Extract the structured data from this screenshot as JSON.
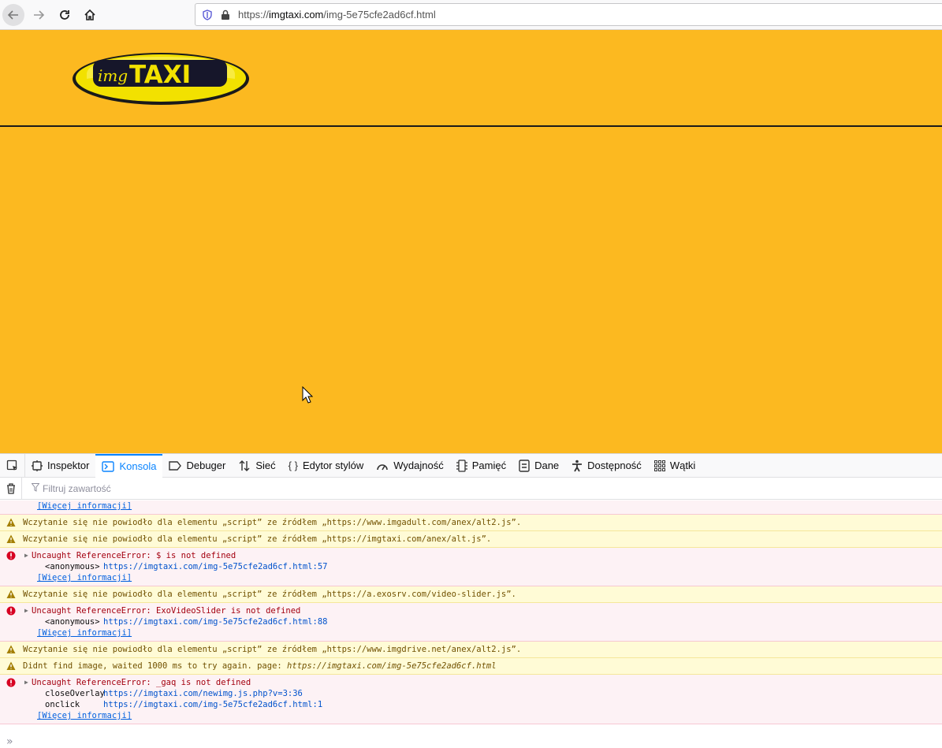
{
  "browser": {
    "url_scheme": "https://",
    "url_host": "imgtaxi.com",
    "url_path": "/img-5e75cfe2ad6cf.html"
  },
  "page": {
    "logo_prefix": "img",
    "logo_main": "TAXI",
    "background": "#fcb920"
  },
  "devtools": {
    "tabs": [
      {
        "label": "Inspektor",
        "icon": "inspector-icon"
      },
      {
        "label": "Konsola",
        "icon": "console-icon",
        "active": true
      },
      {
        "label": "Debuger",
        "icon": "debugger-icon"
      },
      {
        "label": "Sieć",
        "icon": "network-icon"
      },
      {
        "label": "Edytor stylów",
        "icon": "style-editor-icon"
      },
      {
        "label": "Wydajność",
        "icon": "performance-icon"
      },
      {
        "label": "Pamięć",
        "icon": "memory-icon"
      },
      {
        "label": "Dane",
        "icon": "storage-icon"
      },
      {
        "label": "Dostępność",
        "icon": "accessibility-icon"
      },
      {
        "label": "Wątki",
        "icon": "workers-icon"
      }
    ],
    "filter_placeholder": "Filtruj zawartość",
    "more_info": "[Więcej informacji]",
    "messages": {
      "w1": "Wczytanie się nie powiodło dla elementu „script” ze źródłem „https://www.imgadult.com/anex/alt2.js”.",
      "w2": "Wczytanie się nie powiodło dla elementu „script” ze źródłem „https://imgtaxi.com/anex/alt.js”.",
      "e1": "Uncaught ReferenceError: $ is not defined",
      "e1_fn": "<anonymous>",
      "e1_link": "https://imgtaxi.com/img-5e75cfe2ad6cf.html:57",
      "w3": "Wczytanie się nie powiodło dla elementu „script” ze źródłem „https://a.exosrv.com/video-slider.js”.",
      "e2": "Uncaught ReferenceError: ExoVideoSlider is not defined",
      "e2_fn": "<anonymous>",
      "e2_link": "https://imgtaxi.com/img-5e75cfe2ad6cf.html:88",
      "w4": "Wczytanie się nie powiodło dla elementu „script” ze źródłem „https://www.imgdrive.net/anex/alt2.js”.",
      "w5_prefix": "Didnt find image, waited 1000 ms to try again. page: ",
      "w5_url": "https://imgtaxi.com/img-5e75cfe2ad6cf.html",
      "e3": "Uncaught ReferenceError: _gaq is not defined",
      "e3_fn1": "closeOverlay",
      "e3_link1": "https://imgtaxi.com/newimg.js.php?v=3:36",
      "e3_fn2": "onclick",
      "e3_link2": "https://imgtaxi.com/img-5e75cfe2ad6cf.html:1"
    },
    "prompt": "»"
  }
}
